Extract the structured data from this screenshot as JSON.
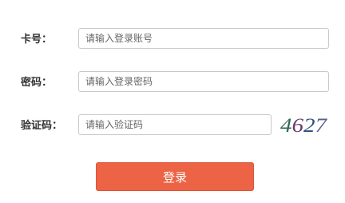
{
  "form": {
    "card_label": "卡号：",
    "card_placeholder": "请输入登录账号",
    "password_label": "密码：",
    "password_placeholder": "请输入登录密码",
    "captcha_label": "验证码：",
    "captcha_placeholder": "请输入验证码",
    "captcha_text": "4627",
    "login_label": "登录"
  },
  "colors": {
    "button_bg": "#ec6445",
    "input_border": "#c9c9c9",
    "label_text": "#333333"
  }
}
